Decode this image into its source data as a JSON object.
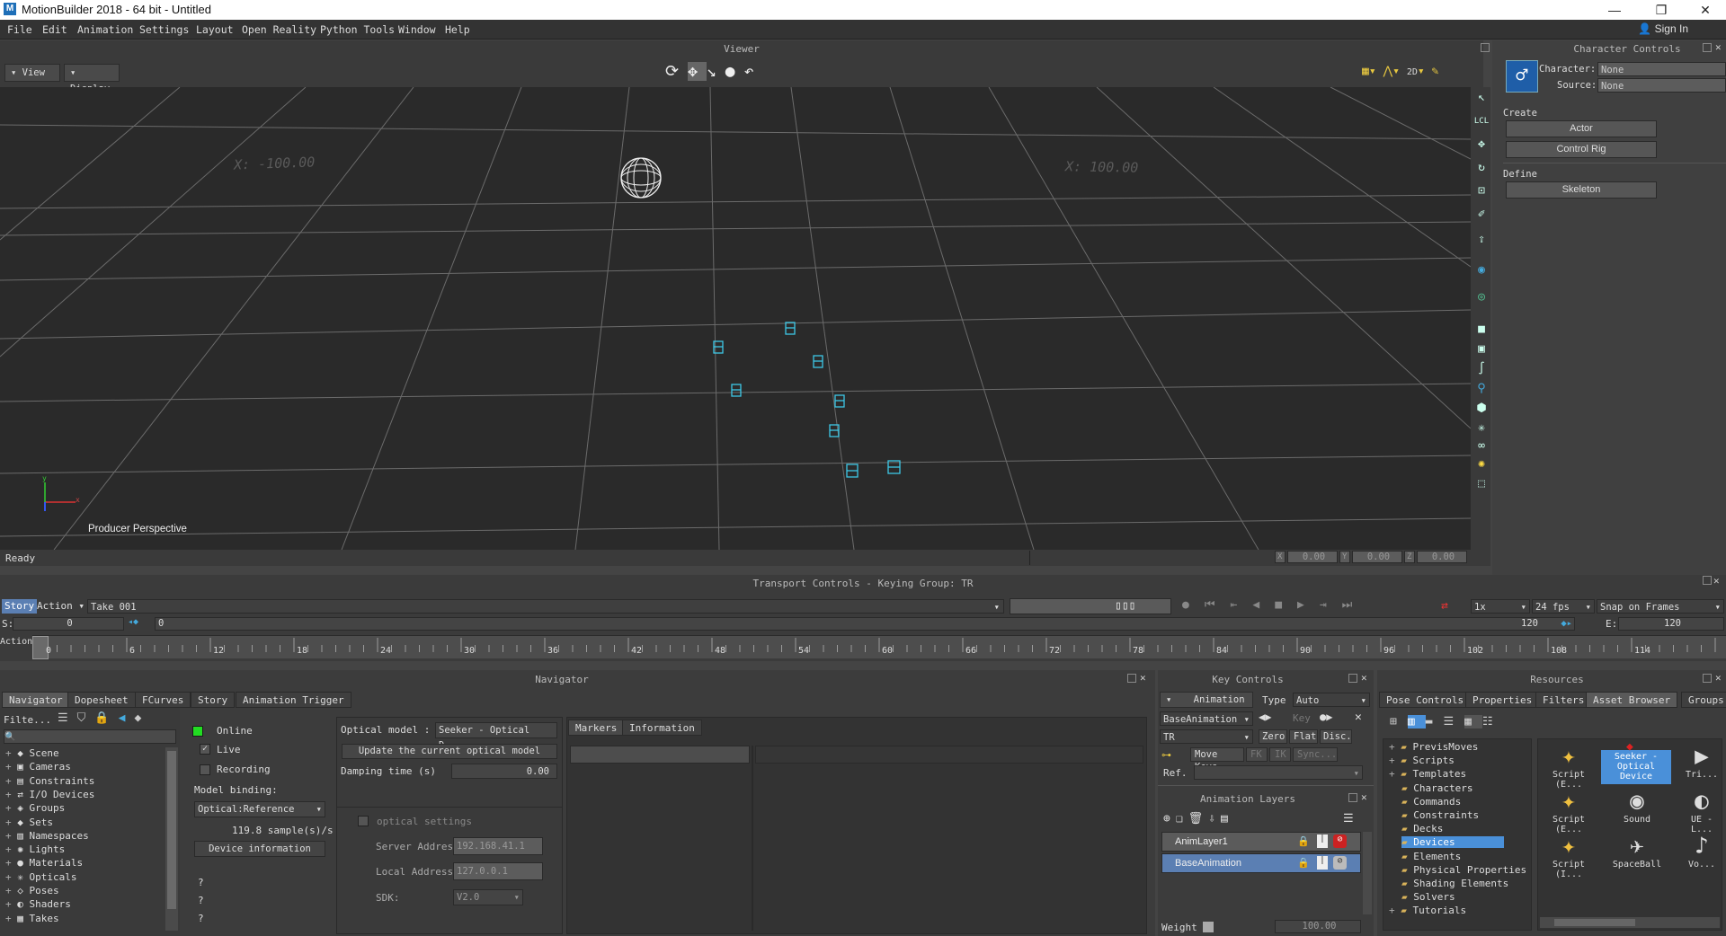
{
  "window": {
    "title": "MotionBuilder 2018 - 64 bit  - Untitled",
    "app_glyph": "M",
    "minimize": "—",
    "restore": "❐",
    "close": "✕"
  },
  "menubar": {
    "items": [
      "File",
      "Edit",
      "Animation",
      "Settings",
      "Layout",
      "Open Reality",
      "Python Tools",
      "Window",
      "Help"
    ],
    "sign_in": "Sign In"
  },
  "viewer": {
    "panel_title": "Viewer",
    "view_btn": "View",
    "display_btn": "Display",
    "label_left": "X: -100.00",
    "label_right": "X: 100.00",
    "camera_name": "Producer Perspective",
    "axis_x": "x",
    "axis_y": "y",
    "view_2d": "2D",
    "status": "Ready",
    "coord_x_label": "X",
    "coord_x": "0.00",
    "coord_y_label": "Y",
    "coord_y": "0.00",
    "coord_z_label": "Z",
    "coord_z": "0.00"
  },
  "character_controls": {
    "panel_title": "Character Controls",
    "character_label": "Character:",
    "character_value": "None",
    "source_label": "Source:",
    "source_value": "None",
    "create_label": "Create",
    "actor_btn": "Actor",
    "control_rig_btn": "Control Rig",
    "define_label": "Define",
    "skeleton_btn": "Skeleton"
  },
  "transport": {
    "panel_title": "Transport Controls  -  Keying Group: TR",
    "story_tab": "Story",
    "action_tab": "Action",
    "take": "Take 001",
    "speed": "1x",
    "fps": "24 fps",
    "snap": "Snap on Frames",
    "start_label": "S:",
    "start_value": "0",
    "current_value": "0",
    "end_value": "120",
    "end_label": "E:",
    "end_field": "120",
    "action_label": "Action",
    "ruler_ticks": [
      "0",
      "6",
      "12",
      "18",
      "24",
      "30",
      "36",
      "42",
      "48",
      "54",
      "60",
      "66",
      "72",
      "78",
      "84",
      "90",
      "96",
      "102",
      "108",
      "114"
    ]
  },
  "navigator": {
    "panel_title": "Navigator",
    "tabs": [
      "Navigator",
      "Dopesheet",
      "FCurves",
      "Story",
      "Animation Trigger"
    ],
    "filter": "Filte...",
    "tree": [
      "Scene",
      "Cameras",
      "Constraints",
      "I/O Devices",
      "Groups",
      "Sets",
      "Namespaces",
      "Lights",
      "Materials",
      "Opticals",
      "Poses",
      "Shaders",
      "Takes"
    ],
    "online": "Online",
    "live": "Live",
    "recording": "Recording",
    "model_binding": "Model binding:",
    "binding_value": "Optical:Reference",
    "sample_rate": "119.8 sample(s)/s",
    "device_info": "Device information",
    "q1": "?",
    "q2": "?",
    "q3": "?",
    "optical_model_label": "Optical model :",
    "optical_model_value": "Seeker - Optical D...",
    "update_btn": "Update the current optical model",
    "damping_label": "Damping time (s)",
    "damping_value": "0.00",
    "optical_settings": "optical settings",
    "server_label": "Server Addres:",
    "server_value": "192.168.41.1",
    "local_label": "Local Address",
    "local_value": "127.0.0.1",
    "sdk_label": "SDK:",
    "sdk_value": "V2.0",
    "markers_tab": "Markers",
    "info_tab": "Information"
  },
  "key_controls": {
    "panel_title": "Key Controls",
    "animation_btn": "Animation",
    "type_label": "Type",
    "type_value": "Auto",
    "base_anim": "BaseAnimation",
    "key_label": "Key",
    "tr_value": "TR",
    "zero": "Zero",
    "flat": "Flat",
    "disc": "Disc.",
    "move_keys": "Move Keys",
    "fk": "FK",
    "ik": "IK",
    "sync": "Sync...",
    "ref_label": "Ref.",
    "layers_title": "Animation Layers",
    "layer1": "AnimLayer1",
    "layer2": "BaseAnimation",
    "weight_label": "Weight",
    "weight_value": "100.00"
  },
  "resources": {
    "panel_title": "Resources",
    "tabs": [
      "Pose Controls",
      "Properties",
      "Filters",
      "Asset Browser",
      "Groups"
    ],
    "tree": [
      "PrevisMoves",
      "Scripts",
      "Templates",
      "Characters",
      "Commands",
      "Constraints",
      "Decks",
      "Devices",
      "Elements",
      "Physical Properties",
      "Shading Elements",
      "Solvers",
      "Tutorials"
    ],
    "assets": [
      "Script (E...",
      "Seeker - Optical Device",
      "Tri...",
      "Script (E...",
      "Sound",
      "UE - L...",
      "Script (I...",
      "SpaceBall",
      "Vo..."
    ]
  },
  "colors": {
    "accent": "#4a90d9",
    "selected": "#5b7fb3",
    "grid": "#6a6a6a",
    "marker": "#3ec8e6",
    "online": "#22dd22"
  }
}
